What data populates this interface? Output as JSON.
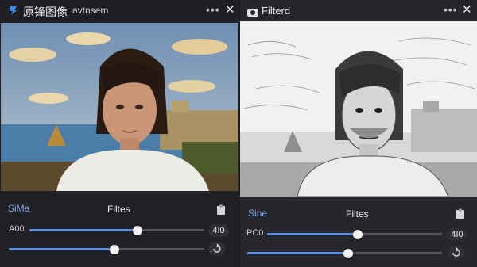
{
  "left": {
    "title": "原锋图像",
    "subtitle": "avtnsem",
    "more_icon": "more-horizontal-icon",
    "close_icon": "close-icon",
    "mode_label": "SiMa",
    "filters_title": "Filtes",
    "clipboard_icon": "clipboard-icon",
    "row1": {
      "label": "A00",
      "level": 0.62,
      "value": "4I0"
    },
    "row2": {
      "label": "",
      "level": 0.54,
      "button_icon": "rotate-icon"
    },
    "accent": "#5b8fe0"
  },
  "right": {
    "title": "Filterd",
    "more_icon": "more-horizontal-icon",
    "close_icon": "close-icon",
    "mode_label": "Sine",
    "filters_title": "Filtes",
    "clipboard_icon": "clipboard-icon",
    "row1": {
      "label": "PC0",
      "level": 0.52,
      "value": "4I0"
    },
    "row2": {
      "label": "",
      "level": 0.52,
      "button_icon": "rotate-icon"
    },
    "accent": "#5b8fe0"
  }
}
